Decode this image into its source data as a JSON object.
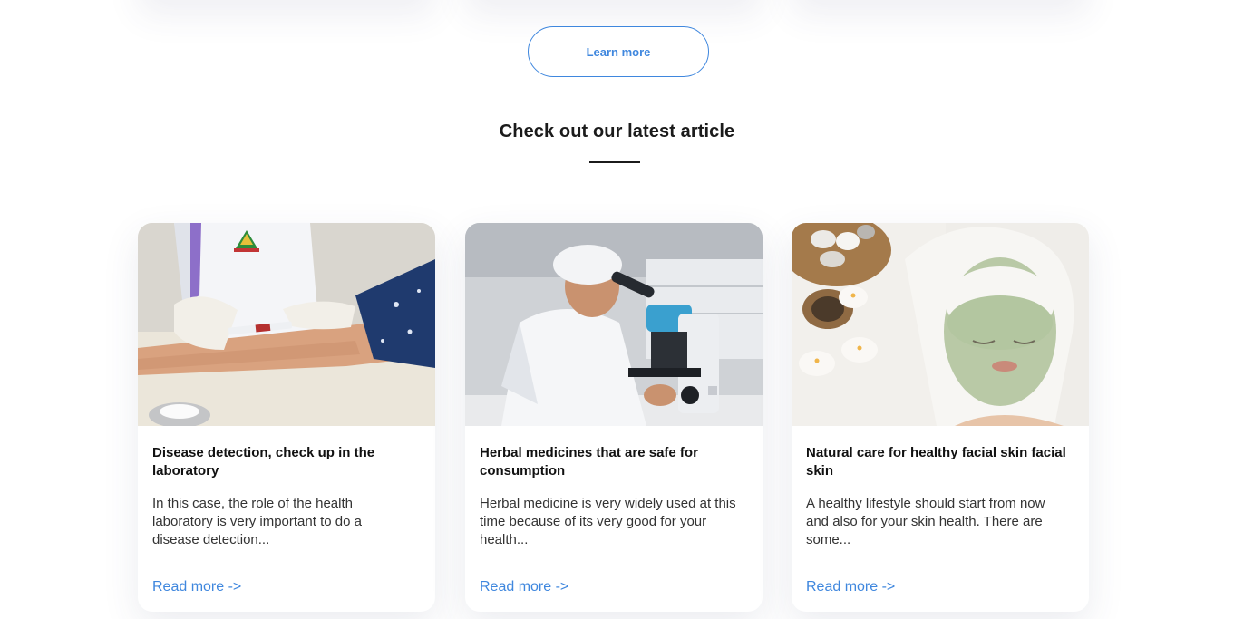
{
  "learn_more": {
    "label": "Learn more"
  },
  "articles_section": {
    "title": "Check out our latest article"
  },
  "articles": [
    {
      "title": "Disease detection, check up in the laboratory",
      "excerpt": "In this case, the role of the health laboratory is very important to do a disease detection...",
      "read_more": "Read more ->"
    },
    {
      "title": "Herbal medicines that are safe for consumption",
      "excerpt": "Herbal medicine is very widely used at this time because of its very good for your health...",
      "read_more": "Read more ->"
    },
    {
      "title": "Natural care for healthy facial skin facial skin",
      "excerpt": "A healthy lifestyle should start from now and also for your skin health. There are some...",
      "read_more": "Read more ->"
    }
  ],
  "colors": {
    "accent": "#3f87de",
    "heading": "#111111",
    "body_text": "#333333"
  }
}
